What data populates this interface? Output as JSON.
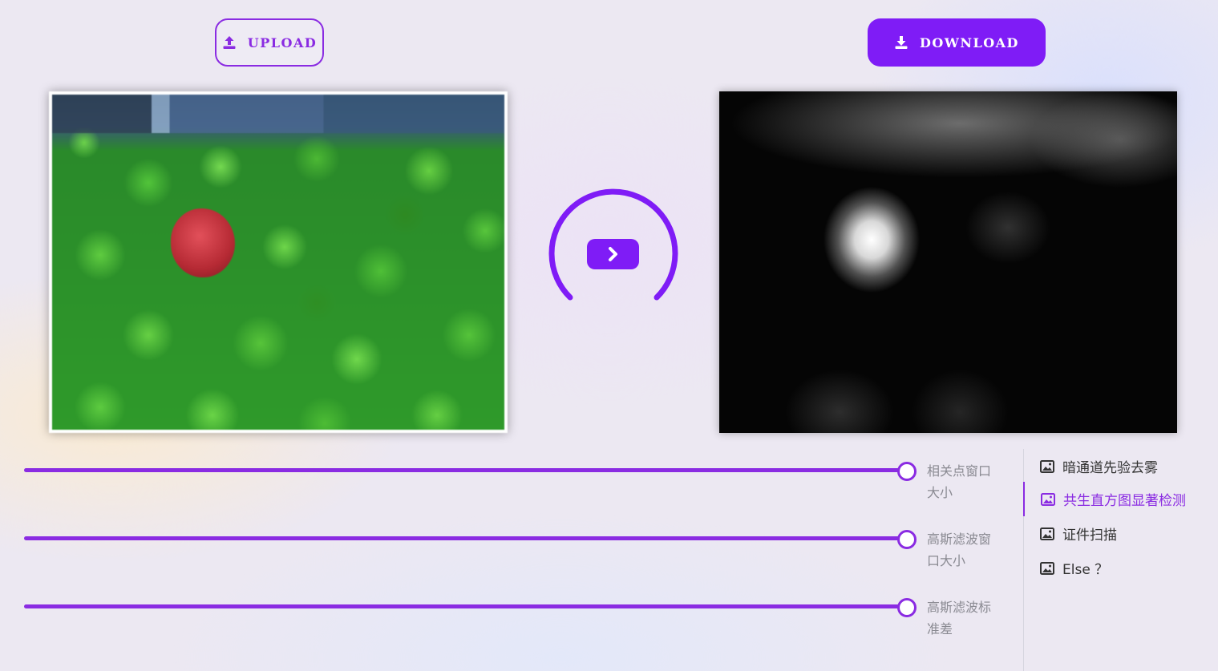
{
  "toolbar": {
    "upload_label": "UPLOAD",
    "download_label": "DOWNLOAD"
  },
  "images": {
    "input_icon": "peppers-image",
    "output_icon": "saliency-heatmap-image"
  },
  "process": {
    "button_icon": "chevron-right-icon"
  },
  "sliders": [
    {
      "label": "相关点窗口大小",
      "value_fraction": 0.99
    },
    {
      "label": "高斯滤波窗口大小",
      "value_fraction": 0.99
    },
    {
      "label": "高斯滤波标准差",
      "value_fraction": 0.99
    }
  ],
  "menu": {
    "items": [
      {
        "label": "暗通道先验去雾",
        "active": false,
        "icon": "image-icon"
      },
      {
        "label": "共生直方图显著检测",
        "active": true,
        "icon": "image-icon"
      },
      {
        "label": "证件扫描",
        "active": false,
        "icon": "image-icon"
      },
      {
        "label": "Else ？",
        "active": false,
        "icon": "image-icon"
      }
    ]
  },
  "colors": {
    "accent": "#7f1cf6",
    "accent_line": "#8a2be2",
    "label_gray": "#8a8a92"
  }
}
